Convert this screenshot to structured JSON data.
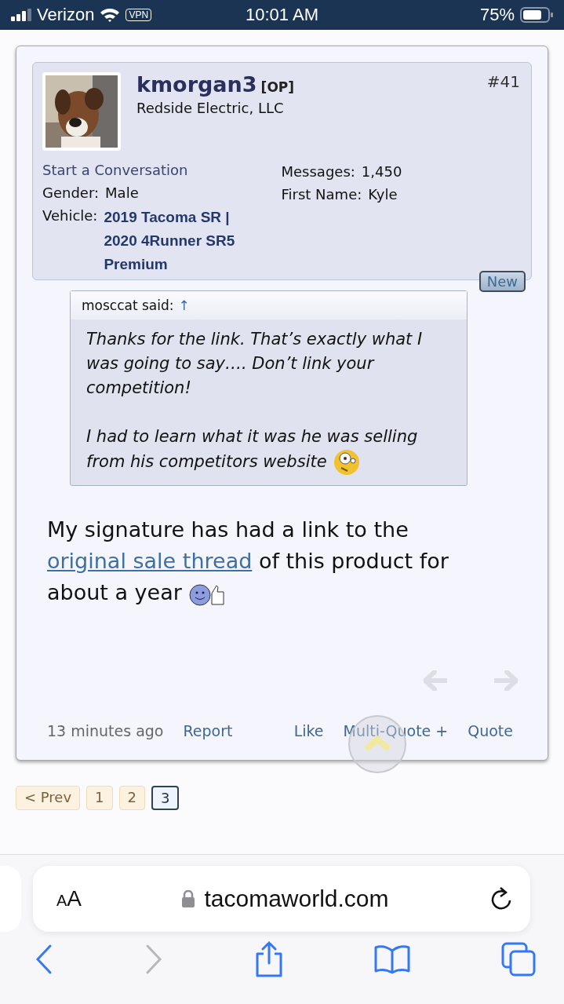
{
  "status_bar": {
    "carrier": "Verizon",
    "vpn": "VPN",
    "time": "10:01 AM",
    "battery": "75%"
  },
  "post": {
    "username": "kmorgan3",
    "op_tag": "[OP]",
    "title": "Redside Electric, LLC",
    "number": "#41",
    "start_conversation": "Start a Conversation",
    "fields": [
      {
        "label": "Gender:",
        "value": "Male",
        "kind": "plain"
      },
      {
        "label": "Vehicle:",
        "value": "2019 Tacoma SR | 2020 4Runner SR5 Premium",
        "kind": "link"
      }
    ],
    "stats": [
      {
        "label": "Messages:",
        "value": "1,450"
      },
      {
        "label": "First Name:",
        "value": "Kyle"
      }
    ],
    "new_badge": "New",
    "quote": {
      "author": "mosccat said:",
      "jump": "↑",
      "paragraphs": [
        "Thanks for the link. That’s exactly what I was going to say…. Don’t link your competition!",
        "I had to learn what it was he was selling from his competitors website"
      ]
    },
    "message": {
      "before": "My signature has had a link to the",
      "link": "original sale thread",
      "after": "of this product for about a year"
    },
    "time": "13 minutes ago",
    "actions_left": [
      "Report"
    ],
    "actions_right": [
      "Like",
      "Multi-Quote +",
      "Quote"
    ]
  },
  "pagination": [
    {
      "label": "< Prev",
      "selected": false
    },
    {
      "label": "1",
      "selected": false
    },
    {
      "label": "2",
      "selected": false
    },
    {
      "label": "3",
      "selected": true
    }
  ],
  "browser": {
    "text_size": "AA",
    "address": "tacomaworld.com",
    "back_disabled": false,
    "forward_disabled": true
  }
}
